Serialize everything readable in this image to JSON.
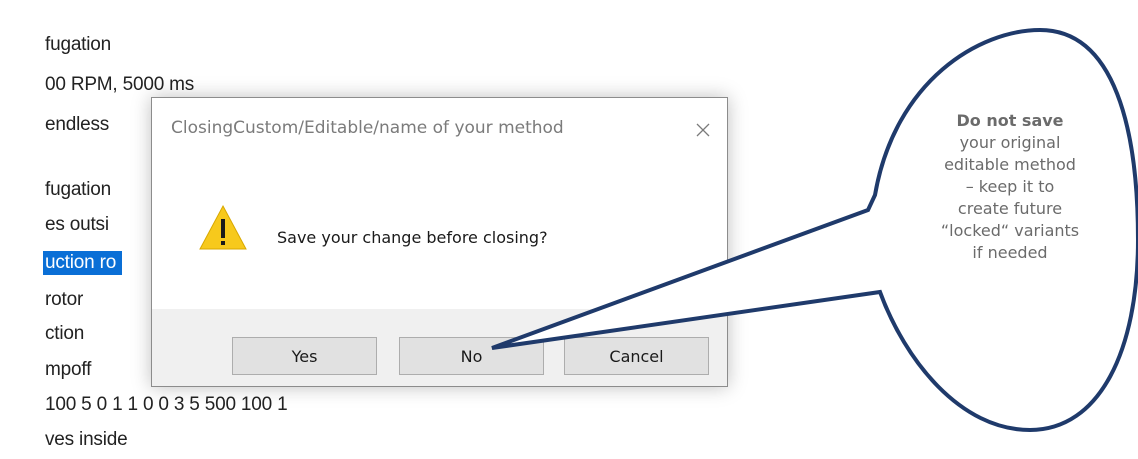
{
  "background_list": {
    "lines": [
      "fugation",
      "00 RPM, 5000 ms",
      "endless",
      "fugation",
      "es outsi",
      "uction ro",
      "rotor",
      "ction",
      "mpoff",
      "100 5 0 1 1 0 0 3 5 500 100 1",
      "ves inside"
    ],
    "selected_index": 5
  },
  "dialog": {
    "title": "ClosingCustom/Editable/name of your method",
    "close_glyph": "✕",
    "icon": "warning-icon",
    "message": "Save your change before closing?",
    "buttons": {
      "yes": "Yes",
      "no": "No",
      "cancel": "Cancel"
    }
  },
  "callout": {
    "bold_text": "Do not save",
    "text": "your original editable method – keep it to create future “locked“ variants if needed",
    "points_to": "no-button",
    "outline_color": "#1f3a6b"
  }
}
